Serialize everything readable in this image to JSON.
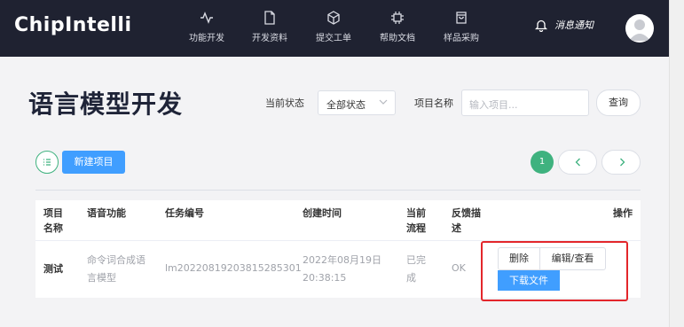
{
  "header": {
    "logo": "ChipIntelli",
    "nav": [
      {
        "label": "功能开发",
        "icon": "activity-icon"
      },
      {
        "label": "开发资料",
        "icon": "document-icon"
      },
      {
        "label": "提交工单",
        "icon": "cube-icon"
      },
      {
        "label": "帮助文档",
        "icon": "chip-icon"
      },
      {
        "label": "样品采购",
        "icon": "shopping-bag-icon"
      }
    ],
    "notification": "消息通知"
  },
  "page": {
    "title": "语言模型开发",
    "filters": {
      "status_label": "当前状态",
      "status_value": "全部状态",
      "name_label": "项目名称",
      "name_placeholder": "输入项目...",
      "query_button": "查询"
    },
    "toolbar": {
      "new_button": "新建项目",
      "current_page": "1"
    }
  },
  "table": {
    "headers": [
      "项目名称",
      "语音功能",
      "任务编号",
      "创建时间",
      "当前流程",
      "反馈描述",
      "操作"
    ],
    "rows": [
      {
        "name": "测试",
        "function": "命令词合成语言模型",
        "task_id": "lm20220819203815285301",
        "created": "2022年08月19日 20:38:15",
        "flow": "已完成",
        "feedback": "OK",
        "actions": {
          "delete": "删除",
          "edit": "编辑/查看",
          "download": "下载文件"
        }
      }
    ]
  },
  "colors": {
    "nav_bg": "#1f2231",
    "primary": "#409eff",
    "success": "#3fb27f",
    "highlight": "#e3262b"
  }
}
